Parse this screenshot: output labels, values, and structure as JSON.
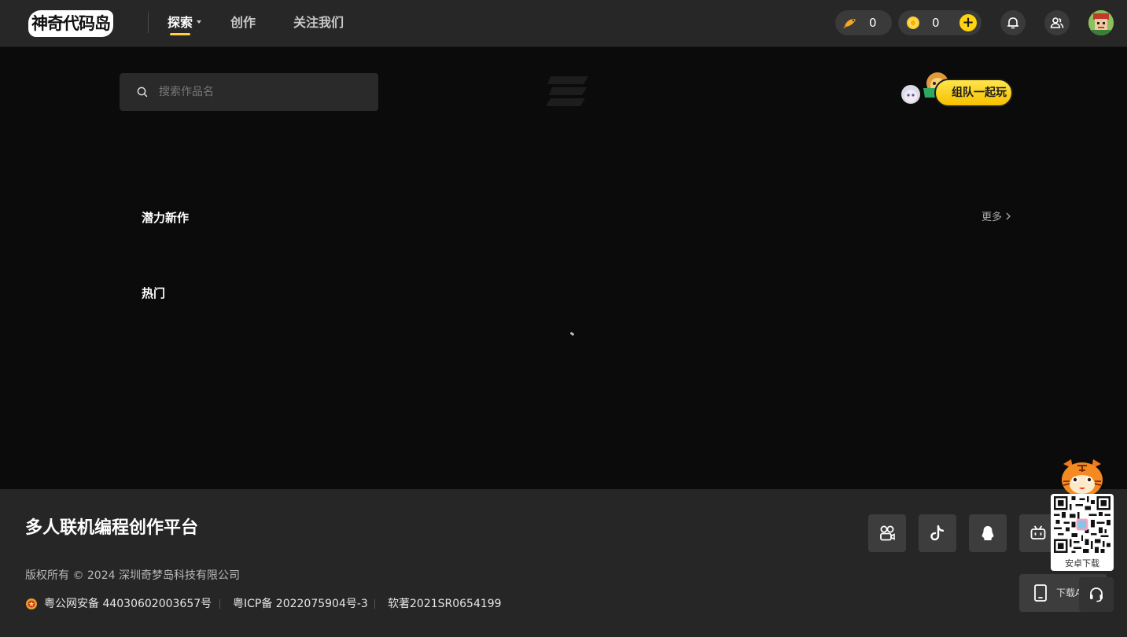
{
  "header": {
    "logo_text": "神奇代码岛",
    "nav": [
      {
        "label": "探索",
        "active": true
      },
      {
        "label": "创作",
        "active": false
      },
      {
        "label": "关注我们",
        "active": false
      }
    ],
    "fish_count": "0",
    "coin_count": "0",
    "add_symbol": "+"
  },
  "search": {
    "placeholder": "搜索作品名"
  },
  "team_banner": {
    "label": "组队一起玩"
  },
  "sections": {
    "potential_new": "潜力新作",
    "more": "更多",
    "popular": "热门"
  },
  "footer": {
    "title": "多人联机编程创作平台",
    "copyright": "版权所有 © 2024 深圳奇梦岛科技有限公司",
    "police_record": "粤公网安备 44030602003657号",
    "icp_record": "粤ICP备 2022075904号-3",
    "software_record": "软著2021SR0654199",
    "download_label": "下载APP",
    "qr_label": "安卓下载"
  },
  "colors": {
    "accent": "#ffd30f",
    "header_bg": "#272727",
    "page_bg": "#0b0b0b",
    "footer_bg": "#262626"
  }
}
